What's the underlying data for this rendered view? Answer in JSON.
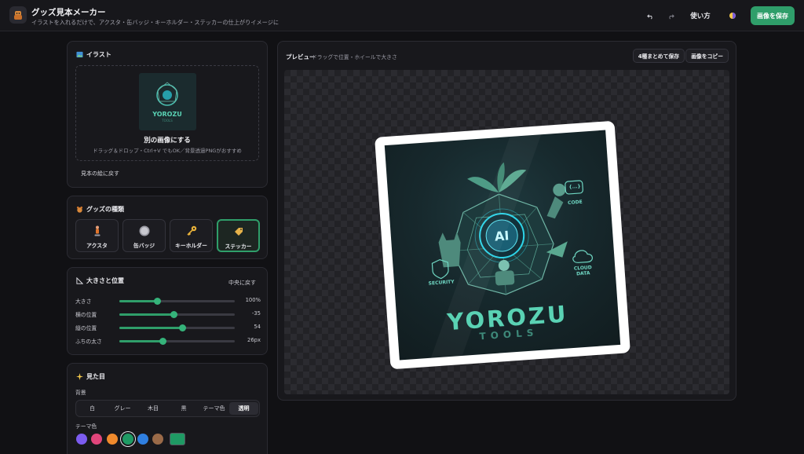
{
  "app": {
    "title": "グッズ見本メーカー",
    "subtitle": "イラストを入れるだけで、アクスタ・缶バッジ・キーホルダー・ステッカーの仕上がりイメージに"
  },
  "header": {
    "undo_icon": "undo-icon",
    "redo_icon": "redo-icon",
    "help_label": "使い方",
    "theme_icon": "theme-toggle-icon",
    "save_label": "画像を保存"
  },
  "illustration": {
    "title": "イラスト",
    "change_label": "別の画像にする",
    "hint": "ドラッグ＆ドロップ・Ctrl+V でもOK／背景透過PNGがおすすめ",
    "reset_label": "見本の絵に戻す"
  },
  "goods": {
    "title": "グッズの種類",
    "types": [
      {
        "label": "アクスタ",
        "icon": "acrylic-stand-icon"
      },
      {
        "label": "缶バッジ",
        "icon": "can-badge-icon"
      },
      {
        "label": "キーホルダー",
        "icon": "keychain-icon"
      },
      {
        "label": "ステッカー",
        "icon": "sticker-icon"
      }
    ],
    "selected": "ステッカー"
  },
  "size_position": {
    "title": "大きさと位置",
    "center_label": "中央に戻す",
    "sliders": [
      {
        "label": "大きさ",
        "value": "100%",
        "level": 0.33
      },
      {
        "label": "横の位置",
        "value": "-35",
        "level": 0.47
      },
      {
        "label": "縦の位置",
        "value": "54",
        "level": 0.55
      },
      {
        "label": "ふちの太さ",
        "value": "26px",
        "level": 0.38
      }
    ]
  },
  "appearance": {
    "title": "見た目",
    "background_label": "背景",
    "background_options": [
      "白",
      "グレー",
      "木目",
      "黒",
      "テーマ色",
      "透明"
    ],
    "background_selected": "透明",
    "theme_color_label": "テーマ色",
    "swatches": [
      "#7c5cf0",
      "#e0457b",
      "#f08a2c",
      "#1f9a64",
      "#2f7fe0",
      "#9a6a48"
    ],
    "selected_swatch": "#1f9a64",
    "custom_color": "#1f9a64"
  },
  "preview": {
    "title": "プレビュー",
    "hint": "ドラッグで位置・ホイールで大きさ",
    "save_all_label": "4種まとめて保存",
    "copy_label": "画像をコピー",
    "artwork": {
      "title": "YOROZU",
      "subtitle": "TOOLS",
      "center_text": "AI",
      "labels": [
        "CODE",
        "SECURITY",
        "CLOUD DATA",
        "{...}"
      ]
    }
  }
}
